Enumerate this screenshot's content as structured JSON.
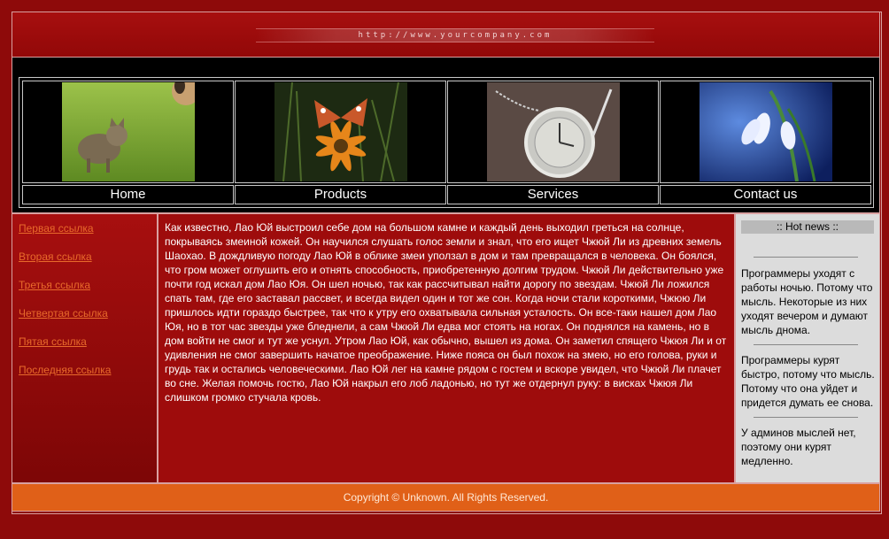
{
  "header": {
    "url": "http://www.yourcompany.com"
  },
  "nav": [
    {
      "label": "Home",
      "image": "kitten-photo"
    },
    {
      "label": "Products",
      "image": "butterfly-photo"
    },
    {
      "label": "Services",
      "image": "pocket-watch-photo"
    },
    {
      "label": "Contact us",
      "image": "snowdrop-photo"
    }
  ],
  "sidebar": {
    "links": [
      "Первая ссылка",
      "Вторая ссылка",
      "Третья ссылка",
      "Четвертая ссылка",
      "Пятая ссылка",
      "Последняя ссылка"
    ]
  },
  "main": {
    "text": "Как известно, Лао Юй выстроил себе дом на большом камне и каждый день выходил греться на солнце, покрываясь змеиной кожей. Он научился слушать голос земли и знал, что его ищет Чжюй Ли из древних земель Шаохао. В дождливую погоду Лао Юй в облике змеи уползал в дом и там превращался в человека. Он боялся, что гром может оглушить его и отнять способность, приобретенную долгим трудом. Чжюй Ли действительно уже почти год искал дом Лао Юя. Он шел ночью, так как рассчитывал найти дорогу по звездам. Чжюй Ли ложился спать там, где его заставал рассвет, и всегда видел один и тот же сон. Когда ночи стали короткими, Чжюю Ли пришлось идти гораздо быстрее, так что к утру его охватывала сильная усталость. Он все-таки нашел дом Лао Юя, но в тот час звезды уже бледнели, а сам Чжюй Ли едва мог стоять на ногах. Он поднялся на камень, но в дом войти не смог и тут же уснул. Утром Лао Юй, как обычно, вышел из дома. Он заметил спящего Чжюя Ли и от удивления не смог завершить начатое преображение. Ниже пояса он был похож на змею, но его голова, руки и грудь так и остались человеческими. Лао Юй лег на камне рядом с гостем и вскоре увидел, что Чжюй Ли плачет во сне. Желая помочь гостю, Лао Юй накрыл его лоб ладонью, но тут же отдернул руку: в висках Чжюя Ли слишком громко стучала кровь."
  },
  "news": {
    "title": ":: Hot news ::",
    "items": [
      "Программеры уходят с работы ночью. Потому что мысль. Некоторые из них уходят вечером и думают мысль днома.",
      "Программеры курят быстро, потому что мысль. Потому что она уйдет и придется думать ее снова.",
      "У админов мыслей нет, поэтому они курят медленно."
    ]
  },
  "footer": {
    "copyright": "Copyright © Unknown. All Rights Reserved."
  },
  "colors": {
    "background": "#8e0a0a",
    "accent": "#e06018",
    "link": "#e86a2b"
  }
}
